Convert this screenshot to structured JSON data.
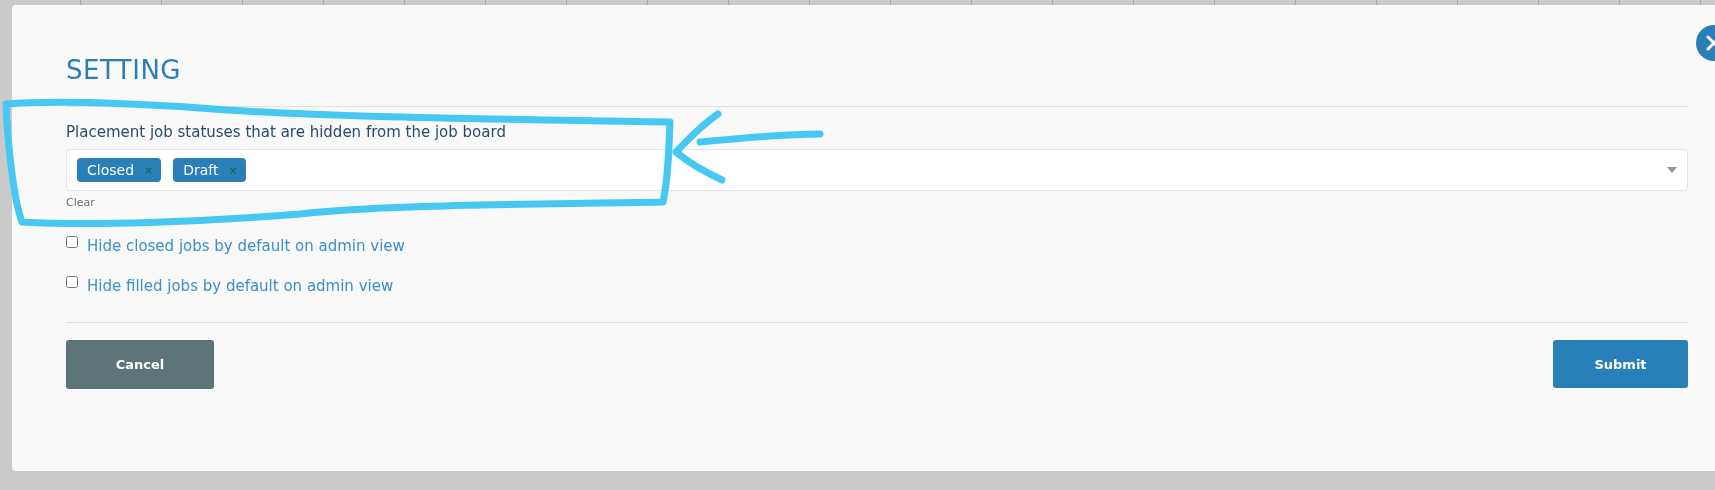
{
  "dialog": {
    "title": "SETTING",
    "status_field": {
      "label": "Placement job statuses that are hidden from the job board",
      "tags": [
        {
          "label": "Closed",
          "remove": "×"
        },
        {
          "label": "Draft",
          "remove": "×"
        }
      ],
      "clear": "Clear"
    },
    "options": [
      {
        "label": "Hide closed jobs by default on admin view",
        "checked": false
      },
      {
        "label": "Hide filled jobs by default on admin view",
        "checked": false
      }
    ],
    "buttons": [
      {
        "label": "Cancel",
        "kind": "secondary"
      },
      {
        "label": "Submit",
        "kind": "primary"
      }
    ]
  }
}
